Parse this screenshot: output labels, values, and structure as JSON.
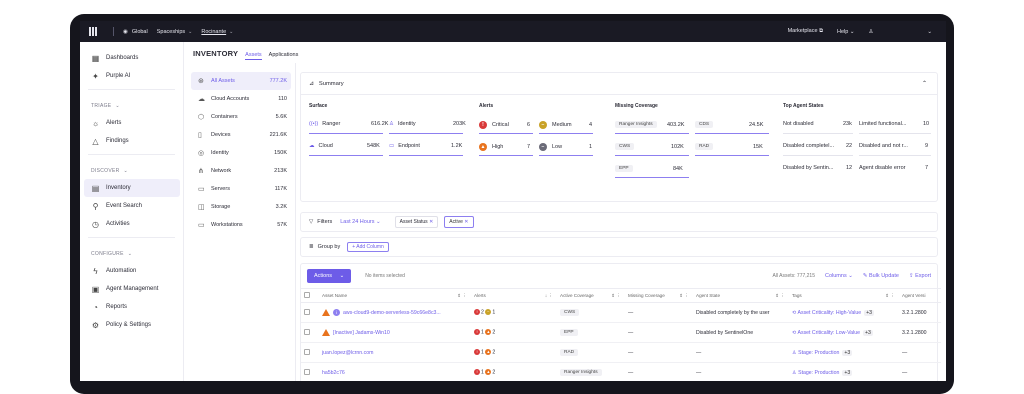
{
  "topbar": {
    "crumbs": [
      "Global",
      "Spaceships",
      "Rocinante"
    ],
    "right": [
      "Marketplace",
      "Help"
    ]
  },
  "nav": {
    "items_top": [
      {
        "label": "Dashboards",
        "icon": "dashboard-icon"
      },
      {
        "label": "Purple AI",
        "icon": "sparkle-icon"
      }
    ],
    "sections": [
      {
        "title": "TRIAGE",
        "items": [
          {
            "label": "Alerts",
            "icon": "alert-icon"
          },
          {
            "label": "Findings",
            "icon": "warning-icon"
          }
        ]
      },
      {
        "title": "DISCOVER",
        "items": [
          {
            "label": "Inventory",
            "icon": "inventory-icon",
            "active": true
          },
          {
            "label": "Event Search",
            "icon": "search-icon"
          },
          {
            "label": "Activities",
            "icon": "activity-icon"
          }
        ]
      },
      {
        "title": "CONFIGURE",
        "items": [
          {
            "label": "Automation",
            "icon": "bolt-icon"
          },
          {
            "label": "Agent Management",
            "icon": "agent-icon"
          },
          {
            "label": "Reports",
            "icon": "report-icon"
          },
          {
            "label": "Policy & Settings",
            "icon": "settings-icon"
          }
        ]
      }
    ]
  },
  "inventory": {
    "title": "INVENTORY",
    "tabs": [
      "Assets",
      "Applications"
    ]
  },
  "asset_list": [
    {
      "label": "All Assets",
      "count": "777.2K",
      "active": true
    },
    {
      "label": "Cloud Accounts",
      "count": "110"
    },
    {
      "label": "Containers",
      "count": "5.6K"
    },
    {
      "label": "Devices",
      "count": "221.6K"
    },
    {
      "label": "Identity",
      "count": "150K"
    },
    {
      "label": "Network",
      "count": "213K"
    },
    {
      "label": "Servers",
      "count": "117K"
    },
    {
      "label": "Storage",
      "count": "3.2K"
    },
    {
      "label": "Workstations",
      "count": "57K"
    }
  ],
  "summary": {
    "title": "Summary",
    "surface": {
      "label": "Surface",
      "items": [
        {
          "label": "Ranger",
          "value": "616.2K"
        },
        {
          "label": "Identity",
          "value": "203K"
        },
        {
          "label": "Cloud",
          "value": "548K"
        },
        {
          "label": "Endpoint",
          "value": "1.2K"
        }
      ]
    },
    "alerts": {
      "label": "Alerts",
      "items": [
        {
          "label": "Critical",
          "value": "6",
          "color": "#d93a3a"
        },
        {
          "label": "Medium",
          "value": "4",
          "color": "#c9a227"
        },
        {
          "label": "High",
          "value": "7",
          "color": "#e8731e"
        },
        {
          "label": "Low",
          "value": "1",
          "color": "#6b6b78"
        }
      ]
    },
    "missing": {
      "label": "Missing Coverage",
      "items": [
        {
          "label": "Ranger Insights",
          "value": "403.2K"
        },
        {
          "label": "CDS",
          "value": "24.5K"
        },
        {
          "label": "CWS",
          "value": "102K"
        },
        {
          "label": "RAD",
          "value": "15K"
        },
        {
          "label": "EPP",
          "value": "84K"
        }
      ]
    },
    "agents": {
      "label": "Top Agent States",
      "items": [
        {
          "label": "Not disabled",
          "value": "23k"
        },
        {
          "label": "Limited functional...",
          "value": "10"
        },
        {
          "label": "Disabled completel...",
          "value": "22"
        },
        {
          "label": "Disabled and not r...",
          "value": "9"
        },
        {
          "label": "Disabled by Sentin...",
          "value": "12"
        },
        {
          "label": "Agent disable error",
          "value": "7"
        }
      ]
    }
  },
  "filters": {
    "label": "Filters",
    "range": "Last 24 Hours",
    "chips": [
      "Asset Status",
      "Active"
    ]
  },
  "groupby": {
    "label": "Group by",
    "add": "+ Add Column"
  },
  "table": {
    "actions": "Actions",
    "selection": "No items selected",
    "total": "All Assets: 777,215",
    "columns_btn": "Columns",
    "bulk": "Bulk Update",
    "export": "Export",
    "headers": [
      "Asset Name",
      "Alerts",
      "Active Coverage",
      "Missing Coverage",
      "Agent State",
      "Tags",
      "Agent Versi"
    ],
    "rows": [
      {
        "name": "aws-cloud9-demo-serverless-59c66e8c3...",
        "warn": true,
        "info": true,
        "a1": "2",
        "a2": "1",
        "a2color": "#c9a227",
        "coverage": "CWS",
        "missing": "—",
        "state": "Disabled completely by the user",
        "tag": "Asset Criticality: High-Value",
        "tagplus": "+3",
        "version": "3.2.1.2800"
      },
      {
        "name": "[Inactive] Jadams-Win10",
        "warn": true,
        "info": false,
        "a1": "1",
        "a2": "2",
        "a2color": "#e8731e",
        "coverage": "EPP",
        "missing": "—",
        "state": "Disabled by SentinelOne",
        "tag": "Asset Criticality: Low-Value",
        "tagplus": "+3",
        "version": "3.2.1.2800"
      },
      {
        "name": "juan.lopez@lcrnn.com",
        "warn": false,
        "info": false,
        "a1": "1",
        "a2": "2",
        "a2color": "#e8731e",
        "coverage": "RAD",
        "missing": "—",
        "state": "—",
        "tag": "Stage: Production",
        "tagplus": "+3",
        "version": "—"
      },
      {
        "name": "ha5b2c76",
        "warn": false,
        "info": false,
        "a1": "1",
        "a2": "2",
        "a2color": "#e8731e",
        "coverage": "Ranger Insights",
        "missing": "—",
        "state": "—",
        "tag": "Stage: Production",
        "tagplus": "+3",
        "version": "—"
      }
    ]
  }
}
